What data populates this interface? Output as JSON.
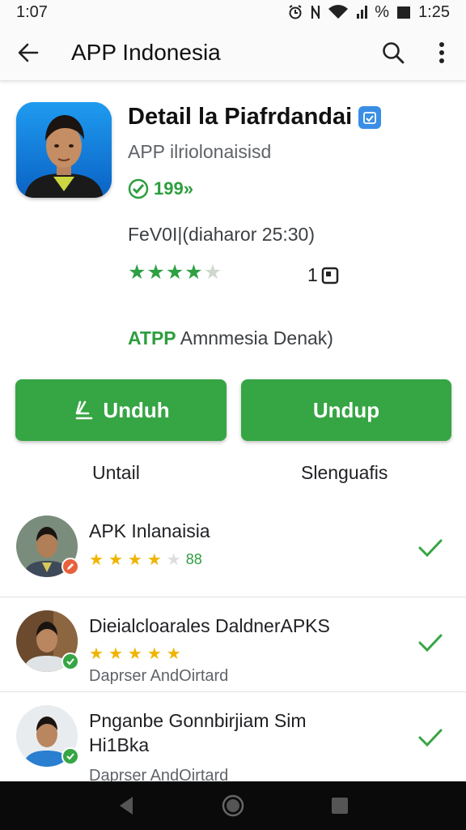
{
  "status_bar": {
    "time_left": "1:07",
    "percent": "%",
    "time_right": "1:25"
  },
  "app_bar": {
    "title": "APP Indonesia",
    "back_icon": "arrow-left-icon",
    "search_icon": "search-icon",
    "menu_icon": "more-vert-icon"
  },
  "app": {
    "title": "Detail la Piafrdandai",
    "subtitle": "APP ilriolonaisisd",
    "download_count": "199»",
    "meta": "FeV0I|(diaharor 25:30)",
    "rating": 4.5,
    "review_count": "1",
    "developer_brand": "ATPP",
    "developer_rest": " Amnmesia Denak)",
    "colors": {
      "accent": "#36a544",
      "verified": "#3a8ee6",
      "star_green": "#2ea043"
    }
  },
  "buttons": {
    "left_label": "Unduh",
    "right_label": "Undup",
    "left_caption": "Untail",
    "right_caption": "Slenguafis"
  },
  "list": [
    {
      "title": "APK Inlanaisia",
      "rating": 3.5,
      "rating_value": "88",
      "badge": "edit"
    },
    {
      "title": "Dieialcloarales DaldnerAPKS",
      "rating": 5,
      "subtitle": "Daprser AndOirtard",
      "badge": "check"
    },
    {
      "title": "Pnganbe Gonnbirjiam Sim",
      "title2": "Hi1Bka",
      "subtitle": "Daprser AndOirtard",
      "badge": "check"
    }
  ]
}
